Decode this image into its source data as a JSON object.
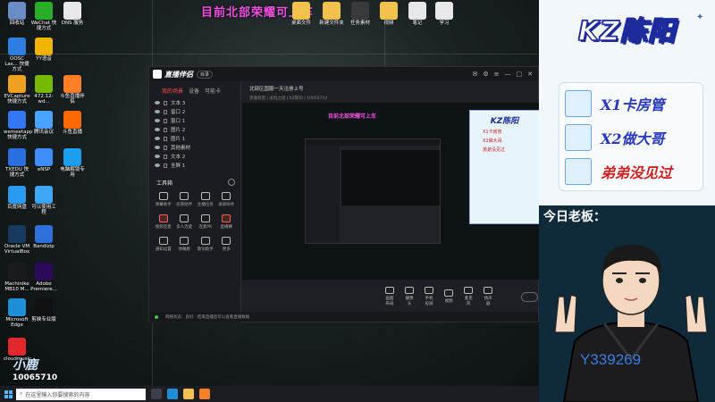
{
  "desktop": {
    "banner": "目前北部荣耀可上车",
    "icons": [
      {
        "label": "回收站",
        "color": "#6a8cc7"
      },
      {
        "label": "WeChat 快捷方式",
        "color": "#2aae2a"
      },
      {
        "label": "DNS 服务",
        "color": "#e8e8e8"
      },
      {
        "label": "OOSC Las... 快捷方式",
        "color": "#2f7de1"
      },
      {
        "label": "YY语音",
        "color": "#f2b400"
      },
      {
        "label": "EVCapture 快捷方式",
        "color": "#f0a020"
      },
      {
        "label": "472.12-wd...",
        "color": "#76b900"
      },
      {
        "label": "斗鱼直播伴侣",
        "color": "#ff7f27"
      },
      {
        "label": "wemeetapp 快捷方式",
        "color": "#3477f5"
      },
      {
        "label": "腾讯会议",
        "color": "#4aa3ff"
      },
      {
        "label": "斗鱼直播",
        "color": "#ff6a00"
      },
      {
        "label": "TXEDU 快捷方式",
        "color": "#2a6fe0"
      },
      {
        "label": "eNSP",
        "color": "#3d8eff"
      },
      {
        "label": "电脑解锁专用",
        "color": "#1ca0f2"
      },
      {
        "label": "百度网盘",
        "color": "#2a9af3"
      },
      {
        "label": "可以使用工程",
        "color": "#3da6f6"
      },
      {
        "label": "Oracle VM VirtualBox",
        "color": "#183a61"
      },
      {
        "label": "Bandizip",
        "color": "#2f6fd9"
      },
      {
        "label": "Machinike MB10 M...",
        "color": "#1a1a1a"
      },
      {
        "label": "Adobe Premiere...",
        "color": "#2a0a5a"
      },
      {
        "label": "Microsoft Edge",
        "color": "#1e8fd6"
      },
      {
        "label": "剪映专业版",
        "color": "#101010"
      },
      {
        "label": "cloudmusic",
        "color": "#e0282d"
      }
    ],
    "top_icons": [
      {
        "label": "桌面文件",
        "color": "#f2c14e"
      },
      {
        "label": "新建文件夹",
        "color": "#f2c14e"
      },
      {
        "label": "任务素材",
        "color": "#3a3a3a"
      },
      {
        "label": "视频",
        "color": "#f2c14e"
      },
      {
        "label": "笔记",
        "color": "#e8e8e8"
      },
      {
        "label": "学习",
        "color": "#e8e8e8"
      }
    ],
    "watermark_logo": "小鹿",
    "watermark_num": "10065710"
  },
  "taskbar": {
    "search_placeholder": "在这里输入你要搜索的内容"
  },
  "app": {
    "name": "直播伴侣",
    "version": "目录",
    "side_tabs": [
      "我的场景",
      "设备",
      "可能卡"
    ],
    "scenes": [
      "文本 3",
      "窗口 2",
      "窗口 1",
      "图片 2",
      "图片 1",
      "其他素材",
      "文本 2",
      "全屏 1"
    ],
    "tools_title": "工具箱",
    "tools": [
      {
        "label": "弹幕助手",
        "hot": false
      },
      {
        "label": "房管助手",
        "hot": false
      },
      {
        "label": "主播任务",
        "hot": false
      },
      {
        "label": "录屏助手",
        "hot": false
      },
      {
        "label": "视频连麦",
        "hot": true
      },
      {
        "label": "多人连麦",
        "hot": false
      },
      {
        "label": "连麦PK",
        "hot": false
      },
      {
        "label": "直播赛",
        "hot": true
      },
      {
        "label": "通知设置",
        "hot": false
      },
      {
        "label": "弹幕姬",
        "hot": false
      },
      {
        "label": "歌词助手",
        "hot": false
      },
      {
        "label": "更多",
        "hot": false
      }
    ],
    "stream_title": "北部区国服一天注册上号",
    "stream_sub": "英雄联盟 | 永恒之塔 | KZ陈阳 | 10055710",
    "inner_banner": "目前北部荣耀可上车",
    "mini_title": "KZ陈阳",
    "mini_lines": [
      "X1卡房管",
      "X2做大哥",
      "弟弟没见过"
    ],
    "preview_tools": [
      "画面布局",
      "摄像头",
      "手机投屏",
      "视频",
      "麦克风",
      "扬声器"
    ],
    "status_text": "网络状态：良好 · 结束直播后可以查看直播数据"
  },
  "panel": {
    "title": "KZ陈阳",
    "items": [
      {
        "text": "X1卡房管",
        "color": "#2838b8"
      },
      {
        "text": "X2做大哥",
        "color": "#2838b8"
      },
      {
        "text": "弟弟没见过",
        "color": "#d02020"
      }
    ],
    "today": "今日老板：",
    "id": "Y339269"
  }
}
